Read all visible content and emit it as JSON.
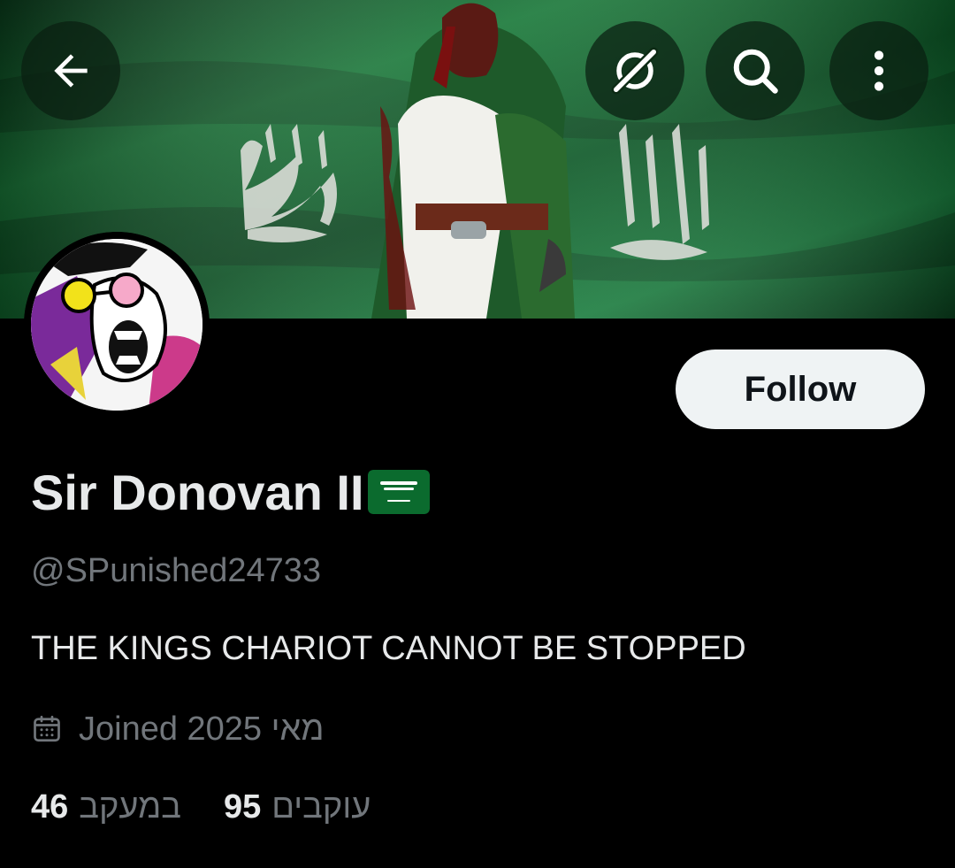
{
  "profile": {
    "display_name": "Sir Donovan II",
    "name_emoji": "saudi-flag-emoji",
    "handle": "@SPunished24733",
    "bio": "THE KINGS CHARIOT CANNOT BE STOPPED",
    "joined": "Joined 2025 מאי",
    "follow_label": "Follow",
    "following_count": "46",
    "following_label": "במעקב",
    "followers_count": "95",
    "followers_label": "עוקבים"
  },
  "header_buttons": {
    "back_icon": "back-arrow-icon",
    "grok_icon": "grok-icon",
    "search_icon": "search-icon",
    "more_icon": "more-vertical-icon"
  },
  "colors": {
    "background": "#000000",
    "primary_text": "#e7e9ea",
    "secondary_text": "#71767b",
    "follow_button_bg": "#eff3f4",
    "follow_button_text": "#0f1419",
    "flag_green": "#0b6b2e"
  }
}
